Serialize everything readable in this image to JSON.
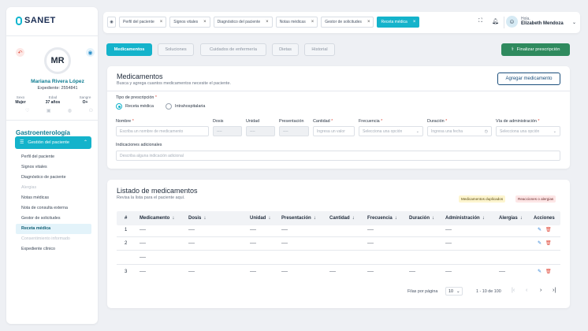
{
  "brand": {
    "name": "SANET"
  },
  "patient": {
    "initials": "MR",
    "name": "Mariana Rivera López",
    "record": "Expediente: 2554841",
    "stats": [
      {
        "label": "Sexo",
        "value": "Mujer"
      },
      {
        "label": "Edad",
        "value": "37 años"
      },
      {
        "label": "Sangre",
        "value": "O+"
      }
    ]
  },
  "sidebar": {
    "specialty": "Gastroenterología",
    "group_label": "Gestión del paciente",
    "items": [
      {
        "label": "Perfil del paciente",
        "state": "normal"
      },
      {
        "label": "Signos vitales",
        "state": "normal"
      },
      {
        "label": "Diagnóstico de paciente",
        "state": "normal"
      },
      {
        "label": "Alergias",
        "state": "disabled"
      },
      {
        "label": "Notas médicas",
        "state": "normal"
      },
      {
        "label": "Nota de consulta externa",
        "state": "normal"
      },
      {
        "label": "Gestor de solicitudes",
        "state": "normal"
      },
      {
        "label": "Receta médica",
        "state": "active"
      },
      {
        "label": "Consentimiento informado",
        "state": "disabled"
      },
      {
        "label": "Expediente clínico",
        "state": "normal"
      }
    ]
  },
  "topbar": {
    "tabs": [
      "Perfil del paciente",
      "Signos vitales",
      "Diagnóstico del paciente",
      "Notas médicas",
      "Gestor de solicitudes",
      "Receta médica"
    ],
    "greeting": "Hola,",
    "user_name": "Elizabeth Mendoza"
  },
  "section_tabs": [
    "Medicamentos",
    "Soluciones",
    "Cuidados de enfermería",
    "Dietas",
    "Historial"
  ],
  "finalize_label": "Finalizar prescripción",
  "form": {
    "title": "Medicamentos",
    "subtitle": "Busca y agrega cuantos medicamentos necesite el paciente.",
    "add_button": "Agregar medicamento",
    "prescription_type_label": "Tipo de prescripción",
    "radio_options": [
      "Receta médica",
      "Intrahospitalaria"
    ],
    "fields": {
      "nombre": {
        "label": "Nombre",
        "placeholder": "Escriba un nombre de medicamento"
      },
      "dosis": {
        "label": "Dosis",
        "placeholder": "----"
      },
      "unidad": {
        "label": "Unidad",
        "placeholder": "----"
      },
      "presentacion": {
        "label": "Presentación",
        "placeholder": "----"
      },
      "cantidad": {
        "label": "Cantidad",
        "placeholder": "Ingresa un valor"
      },
      "frecuencia": {
        "label": "Frecuencia",
        "placeholder": "Selecciona una opción"
      },
      "duracion": {
        "label": "Duración",
        "placeholder": "Ingresa una fecha"
      },
      "via": {
        "label": "Vía de administración",
        "placeholder": "Selecciona una opción"
      },
      "indicaciones": {
        "label": "Indicaciones adicionales",
        "placeholder": "Describa alguna indicación adicional"
      }
    }
  },
  "list": {
    "title": "Listado de medicamentos",
    "subtitle": "Revisa la lista para el paciente aquí.",
    "tags": [
      "Medicamentos duplicados",
      "Reacciones o alergias"
    ],
    "columns": [
      "#",
      "Medicamento",
      "Dosis",
      "Unidad",
      "Presentación",
      "Cantidad",
      "Frecuencia",
      "Duración",
      "Administración",
      "Alergias",
      "Acciones"
    ],
    "rows": [
      {
        "num": "1",
        "medicamento": "----",
        "dosis": "----",
        "unidad": "----",
        "presentacion": "----",
        "cantidad": "",
        "frecuencia": "----",
        "duracion": "",
        "administracion": "----",
        "alergias": ""
      },
      {
        "num": "2",
        "medicamento": "----",
        "dosis": "----",
        "unidad": "----",
        "presentacion": "----",
        "cantidad": "",
        "frecuencia": "----",
        "duracion": "",
        "administracion": "----",
        "alergias": ""
      },
      {
        "num": "",
        "medicamento": "----",
        "dosis": "",
        "unidad": "",
        "presentacion": "",
        "cantidad": "",
        "frecuencia": "",
        "duracion": "",
        "administracion": "",
        "alergias": ""
      },
      {
        "num": "3",
        "medicamento": "----",
        "dosis": "----",
        "unidad": "----",
        "presentacion": "----",
        "cantidad": "----",
        "frecuencia": "----",
        "duracion": "----",
        "administracion": "----",
        "alergias": "----"
      }
    ],
    "pager": {
      "rows_label": "Filas por página",
      "rows_value": "10",
      "range": "1 - 10 de 100"
    }
  },
  "colors": {
    "accent": "#14b3cb",
    "primary_text": "#0f7d93",
    "finalize": "#2f8a5e",
    "danger": "#e04c3d",
    "edit": "#2a7fd4"
  }
}
